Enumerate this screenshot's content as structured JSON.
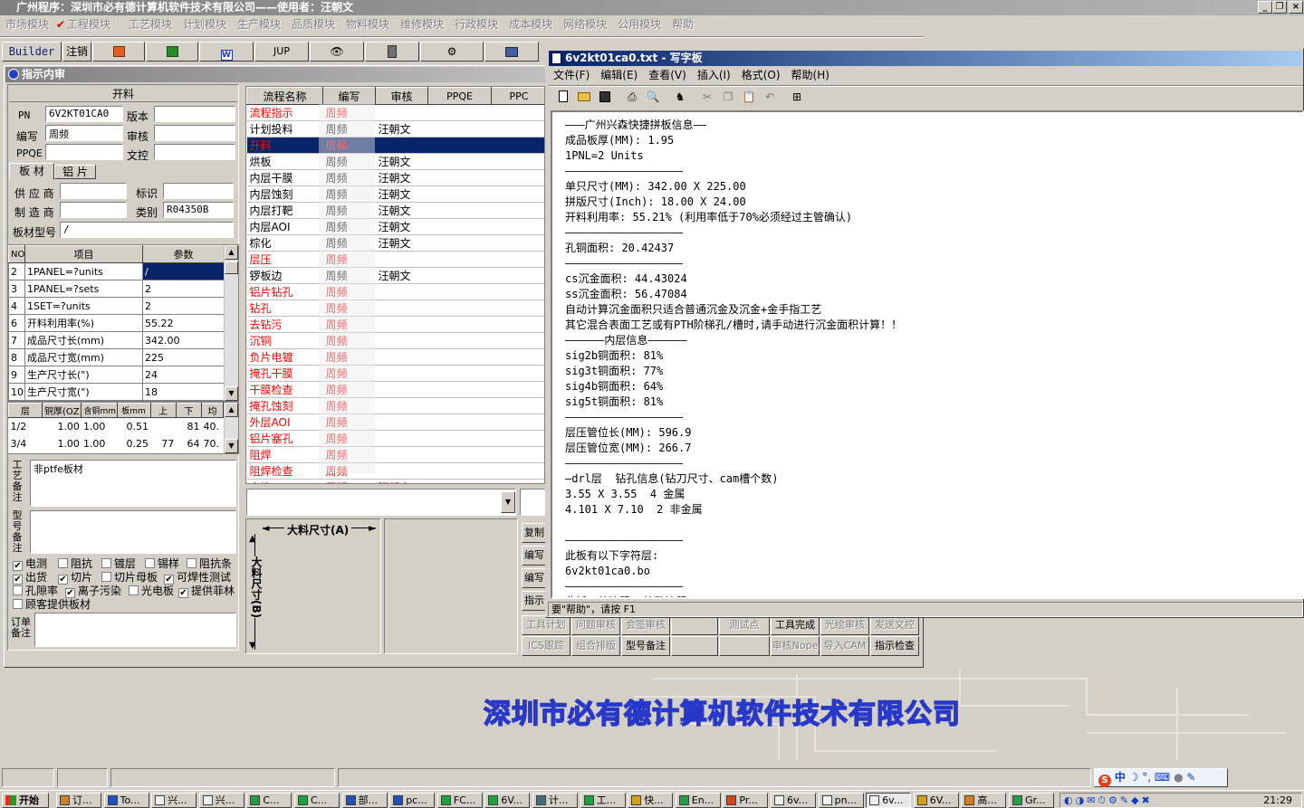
{
  "main_title": "广州程序：深圳市必有德计算机软件技术有限公司——使用者：汪朝文",
  "window_buttons": {
    "minimize": "_",
    "restore": "❐",
    "close": "×"
  },
  "menu": [
    "市场模块",
    "工程模块",
    "工艺模块",
    "计划模块",
    "生产模块",
    "品质模块",
    "物料模块",
    "维修模块",
    "行政模块",
    "成本模块",
    "网络模块",
    "公用模块",
    "帮助"
  ],
  "toolbar": {
    "builder": "Builder",
    "logout": "注销",
    "jup": "JUP",
    "word_icon": "W"
  },
  "panel_title": "指示内审",
  "form": {
    "section_title": "开料",
    "pn_label": "PN",
    "pn_value": "6V2KT01CA0",
    "version_label": "版本",
    "version_value": "",
    "author_label": "编写",
    "author_value": "周频",
    "review_label": "审核",
    "review_value": "",
    "ppqe_label": "PPQE",
    "ppqe_value": "",
    "doc_label": "文控",
    "doc_value": "",
    "tab_board": "板 材",
    "tab_al": "铝 片",
    "supplier_label": "供 应 商",
    "supplier_value": "",
    "mark_label": "标识",
    "mark_value": "",
    "maker_label": "制 造 商",
    "maker_value": "",
    "category_label": "类别",
    "category_value": "R04350B",
    "board_model_label": "板材型号",
    "board_model_value": "/"
  },
  "params_table": {
    "headers": [
      "NO",
      "项目",
      "参数"
    ],
    "rows": [
      [
        "2",
        "1PANEL=?units",
        "/"
      ],
      [
        "3",
        "1PANEL=?sets",
        "2"
      ],
      [
        "4",
        "1SET=?units",
        "2"
      ],
      [
        "6",
        "开料利用率(%)",
        "55.22"
      ],
      [
        "7",
        "成品尺寸长(mm)",
        "342.00"
      ],
      [
        "8",
        "成品尺寸宽(mm)",
        "225"
      ],
      [
        "9",
        "生产尺寸长(\")",
        "24"
      ],
      [
        "10",
        "生产尺寸宽(\")",
        "18"
      ]
    ]
  },
  "layer_table": {
    "headers": [
      "层",
      "铜厚(OZ)",
      "含铜mm",
      "板mm",
      "上",
      "下",
      "均"
    ],
    "rows": [
      [
        "1/2",
        "1.00",
        "1.00",
        "0.51",
        "",
        "81",
        "40."
      ],
      [
        "3/4",
        "1.00",
        "1.00",
        "0.25",
        "77",
        "64",
        "70."
      ]
    ]
  },
  "remarks": {
    "process_label": "工艺备注",
    "process_value": "非ptfe板材",
    "model_label": "型号备注",
    "model_value": "",
    "order_label": "订单备注",
    "order_value": ""
  },
  "checkboxes": [
    {
      "label": "电测",
      "checked": true
    },
    {
      "label": "阻抗",
      "checked": false
    },
    {
      "label": "镀层",
      "checked": false
    },
    {
      "label": "锡样",
      "checked": false
    },
    {
      "label": "阻抗条",
      "checked": false
    },
    {
      "label": "出货",
      "checked": true
    },
    {
      "label": "切片",
      "checked": true
    },
    {
      "label": "切片母板",
      "checked": false
    },
    {
      "label": "可焊性测试",
      "checked": true
    },
    {
      "label": "孔隙率",
      "checked": false
    },
    {
      "label": "离子污染",
      "checked": true
    },
    {
      "label": "光电板",
      "checked": false
    },
    {
      "label": "提供菲林",
      "checked": true
    },
    {
      "label": "顾客提供板材",
      "checked": false
    }
  ],
  "flow_table": {
    "headers": [
      "流程名称",
      "编写",
      "审核",
      "PPQE",
      "PPC"
    ],
    "rows": [
      {
        "name": "流程指示",
        "author": "周频",
        "reviewer": "",
        "red": true,
        "selected": false
      },
      {
        "name": "计划投料",
        "author": "周频",
        "reviewer": "汪朝文",
        "red": false,
        "selected": false
      },
      {
        "name": "开料",
        "author": "周频",
        "reviewer": "",
        "red": true,
        "selected": true
      },
      {
        "name": "烘板",
        "author": "周频",
        "reviewer": "汪朝文",
        "red": false,
        "selected": false
      },
      {
        "name": "内层干膜",
        "author": "周频",
        "reviewer": "汪朝文",
        "red": false,
        "selected": false
      },
      {
        "name": "内层蚀刻",
        "author": "周频",
        "reviewer": "汪朝文",
        "red": false,
        "selected": false
      },
      {
        "name": "内层打靶",
        "author": "周频",
        "reviewer": "汪朝文",
        "red": false,
        "selected": false
      },
      {
        "name": "内层AOI",
        "author": "周频",
        "reviewer": "汪朝文",
        "red": false,
        "selected": false
      },
      {
        "name": "棕化",
        "author": "周频",
        "reviewer": "汪朝文",
        "red": false,
        "selected": false
      },
      {
        "name": "层压",
        "author": "周频",
        "reviewer": "",
        "red": true,
        "selected": false
      },
      {
        "name": "锣板边",
        "author": "周频",
        "reviewer": "汪朝文",
        "red": false,
        "selected": false
      },
      {
        "name": "铝片钻孔",
        "author": "周频",
        "reviewer": "",
        "red": true,
        "selected": false
      },
      {
        "name": "钻孔",
        "author": "周频",
        "reviewer": "",
        "red": true,
        "selected": false
      },
      {
        "name": "去钻污",
        "author": "周频",
        "reviewer": "",
        "red": true,
        "selected": false
      },
      {
        "name": "沉铜",
        "author": "周频",
        "reviewer": "",
        "red": true,
        "selected": false
      },
      {
        "name": "负片电镀",
        "author": "周频",
        "reviewer": "",
        "red": true,
        "selected": false
      },
      {
        "name": "掩孔干膜",
        "author": "周频",
        "reviewer": "",
        "red": true,
        "selected": false
      },
      {
        "name": "干膜检查",
        "author": "周频",
        "reviewer": "",
        "red": true,
        "selected": false
      },
      {
        "name": "掩孔蚀刻",
        "author": "周频",
        "reviewer": "",
        "red": true,
        "selected": false
      },
      {
        "name": "外层AOI",
        "author": "周频",
        "reviewer": "",
        "red": true,
        "selected": false
      },
      {
        "name": "铝片塞孔",
        "author": "周频",
        "reviewer": "",
        "red": true,
        "selected": false
      },
      {
        "name": "阻焊",
        "author": "周频",
        "reviewer": "",
        "red": true,
        "selected": false
      },
      {
        "name": "阻焊检查",
        "author": "周频",
        "reviewer": "",
        "red": true,
        "selected": false
      },
      {
        "name": "字符",
        "author": "周频",
        "reviewer": "汪朝文",
        "red": true,
        "selected": false
      }
    ]
  },
  "dimension": {
    "a_label": "大料尺寸(A)",
    "b_label": "大料尺寸(B)"
  },
  "side_buttons": [
    "复制",
    "编写",
    "编写",
    "指示"
  ],
  "bottom_buttons_row1": [
    "工具计划",
    "问题审核",
    "会签审核",
    "",
    "测试点",
    "工具完成",
    "光绘审核",
    "发送文控"
  ],
  "bottom_buttons_row2": [
    "ICS跟踪",
    "组合排版",
    "型号备注",
    "",
    "",
    "审核Nope",
    "导入CAM",
    "指示检查"
  ],
  "watermark": "深圳市必有德计算机软件技术有限公司",
  "wordpad": {
    "title": "6v2kt01ca0.txt - 写字板",
    "menu": [
      "文件(F)",
      "编辑(E)",
      "查看(V)",
      "插入(I)",
      "格式(O)",
      "帮助(H)"
    ],
    "status": "要\"帮助\"，请按 F1",
    "lines": [
      "———广州兴森快捷拼板信息——",
      "成品板厚(MM): 1.95",
      "1PNL=2 Units",
      "——————————————————",
      "单只尺寸(MM): 342.00 X 225.00",
      "拼版尺寸(Inch): 18.00 X 24.00",
      "开料利用率: 55.21% (利用率低于70%必须经过主管确认)",
      "——————————————————",
      "孔铜面积: 20.42437",
      "——————————————————",
      "cs沉金面积: 44.43024",
      "ss沉金面积: 56.47084",
      "自动计算沉金面积只适合普通沉金及沉金+金手指工艺",
      "其它混合表面工艺或有PTH阶梯孔/槽时,请手动进行沉金面积计算！！",
      "——————内层信息——————",
      "sig2b铜面积: 81%",
      "sig3t铜面积: 77%",
      "sig4b铜面积: 64%",
      "sig5t铜面积: 81%",
      "——————————————————",
      "层压管位长(MM): 596.9",
      "层压管位宽(MM): 266.7",
      "——————————————————",
      "—drl层  钻孔信息(钻刀尺寸、cam槽个数)",
      "3.55 X 3.55  4 金属",
      "4.101 X 7.10  2 非金属",
      "",
      "——————————————————",
      "此板有以下字符层:",
      "6v2kt01ca0.bo",
      "——————————————————",
      "此板工艺流程  掩孔流程"
    ]
  },
  "taskbar": {
    "start": "开始",
    "tasks": [
      "订...",
      "To...",
      "兴...",
      "兴...",
      "C...",
      "C...",
      "部...",
      "pc...",
      "FC...",
      "6V...",
      "计...",
      "工...",
      "快...",
      "En...",
      "Pr...",
      "6v...",
      "pn...",
      "6v...",
      "6V...",
      "高...",
      "Gr..."
    ],
    "clock": "21:29",
    "ime": "中"
  }
}
